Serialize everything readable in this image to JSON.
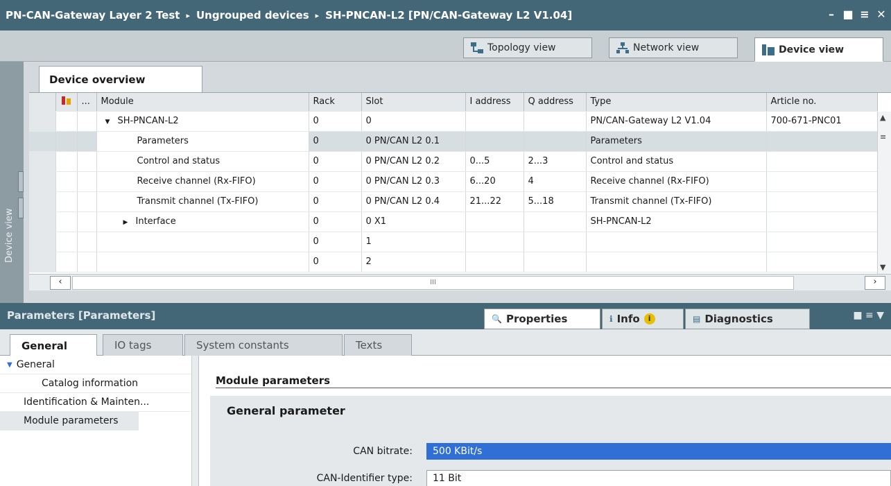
{
  "titlebar": {
    "crumbs": [
      "PN-CAN-Gateway Layer 2 Test",
      "Ungrouped devices",
      "SH-PNCAN-L2 [PN/CAN-Gateway L2 V1.04]"
    ],
    "sep": "▸"
  },
  "views": {
    "topology": "Topology view",
    "network": "Network view",
    "device": "Device view"
  },
  "sidebar": {
    "label": "Device view"
  },
  "overview": {
    "tab": "Device overview",
    "columns": [
      "...",
      "Module",
      "Rack",
      "Slot",
      "I address",
      "Q address",
      "Type",
      "Article no."
    ],
    "rows": [
      {
        "module": "SH-PNCAN-L2",
        "rack": "0",
        "slot": "0",
        "i": "",
        "q": "",
        "type": "PN/CAN-Gateway L2 V1.04",
        "article": "700-671-PNC01"
      },
      {
        "module": "Parameters",
        "rack": "0",
        "slot": "0 PN/CAN L2 0.1",
        "i": "",
        "q": "",
        "type": "Parameters",
        "article": ""
      },
      {
        "module": "Control and status",
        "rack": "0",
        "slot": "0 PN/CAN L2 0.2",
        "i": "0...5",
        "q": "2...3",
        "type": "Control and status",
        "article": ""
      },
      {
        "module": "Receive channel (Rx-FIFO)",
        "rack": "0",
        "slot": "0 PN/CAN L2 0.3",
        "i": "6...20",
        "q": "4",
        "type": "Receive channel (Rx-FIFO)",
        "article": ""
      },
      {
        "module": "Transmit channel (Tx-FIFO)",
        "rack": "0",
        "slot": "0 PN/CAN L2 0.4",
        "i": "21...22",
        "q": "5...18",
        "type": "Transmit channel (Tx-FIFO)",
        "article": ""
      },
      {
        "module": "Interface",
        "rack": "0",
        "slot": "0 X1",
        "i": "",
        "q": "",
        "type": "SH-PNCAN-L2",
        "article": ""
      },
      {
        "module": "",
        "rack": "0",
        "slot": "1",
        "i": "",
        "q": "",
        "type": "",
        "article": ""
      },
      {
        "module": "",
        "rack": "0",
        "slot": "2",
        "i": "",
        "q": "",
        "type": "",
        "article": ""
      }
    ],
    "hscroll_label": "III"
  },
  "props": {
    "title": "Parameters [Parameters]",
    "tabs": {
      "properties": "Properties",
      "info": "Info",
      "diagnostics": "Diagnostics"
    },
    "subtabs": [
      "General",
      "IO tags",
      "System constants",
      "Texts"
    ]
  },
  "nav": {
    "items": [
      "General",
      "Catalog information",
      "Identification & Mainten...",
      "Module parameters"
    ]
  },
  "content": {
    "section": "Module parameters",
    "group": "General parameter",
    "params": [
      {
        "label": "CAN bitrate:",
        "value": "500 KBit/s"
      },
      {
        "label": "CAN-Identifier type:",
        "value": "11 Bit"
      }
    ]
  },
  "colors": {
    "header": "#446778",
    "highlight": "#2f6fd6",
    "panel": "#d3d9dc"
  }
}
